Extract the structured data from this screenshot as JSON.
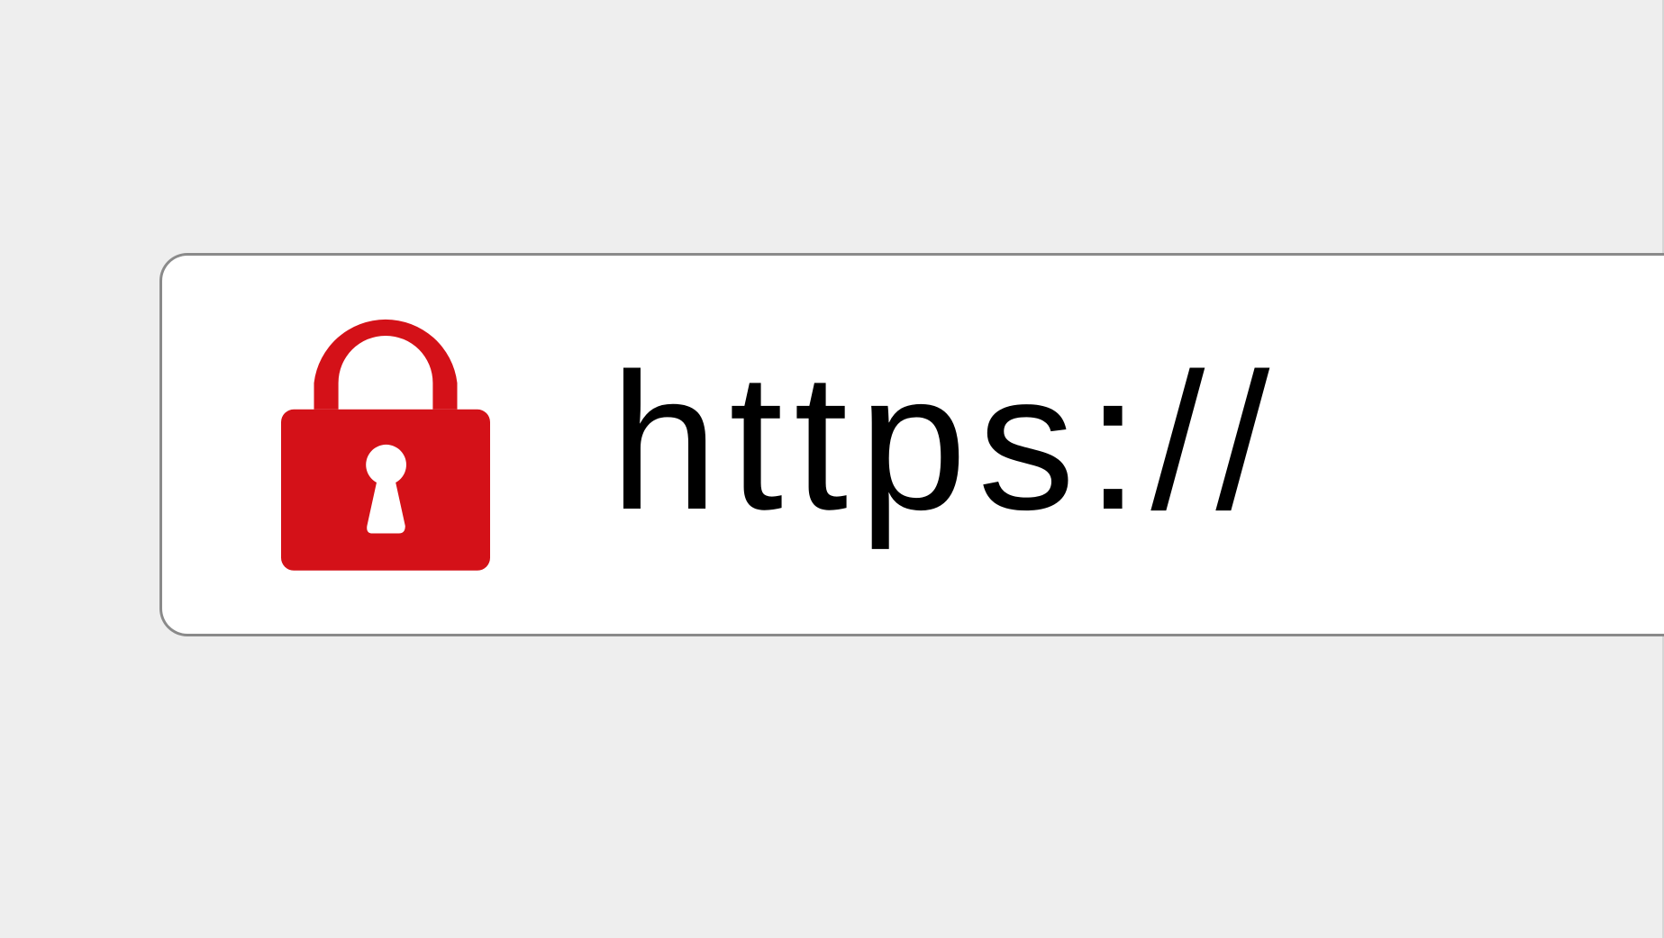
{
  "address_bar": {
    "url_text": "https://",
    "lock_icon": "padlock-icon",
    "lock_color": "#d41118",
    "border_color": "#8a8a8a",
    "background_color": "#eeeeee"
  }
}
